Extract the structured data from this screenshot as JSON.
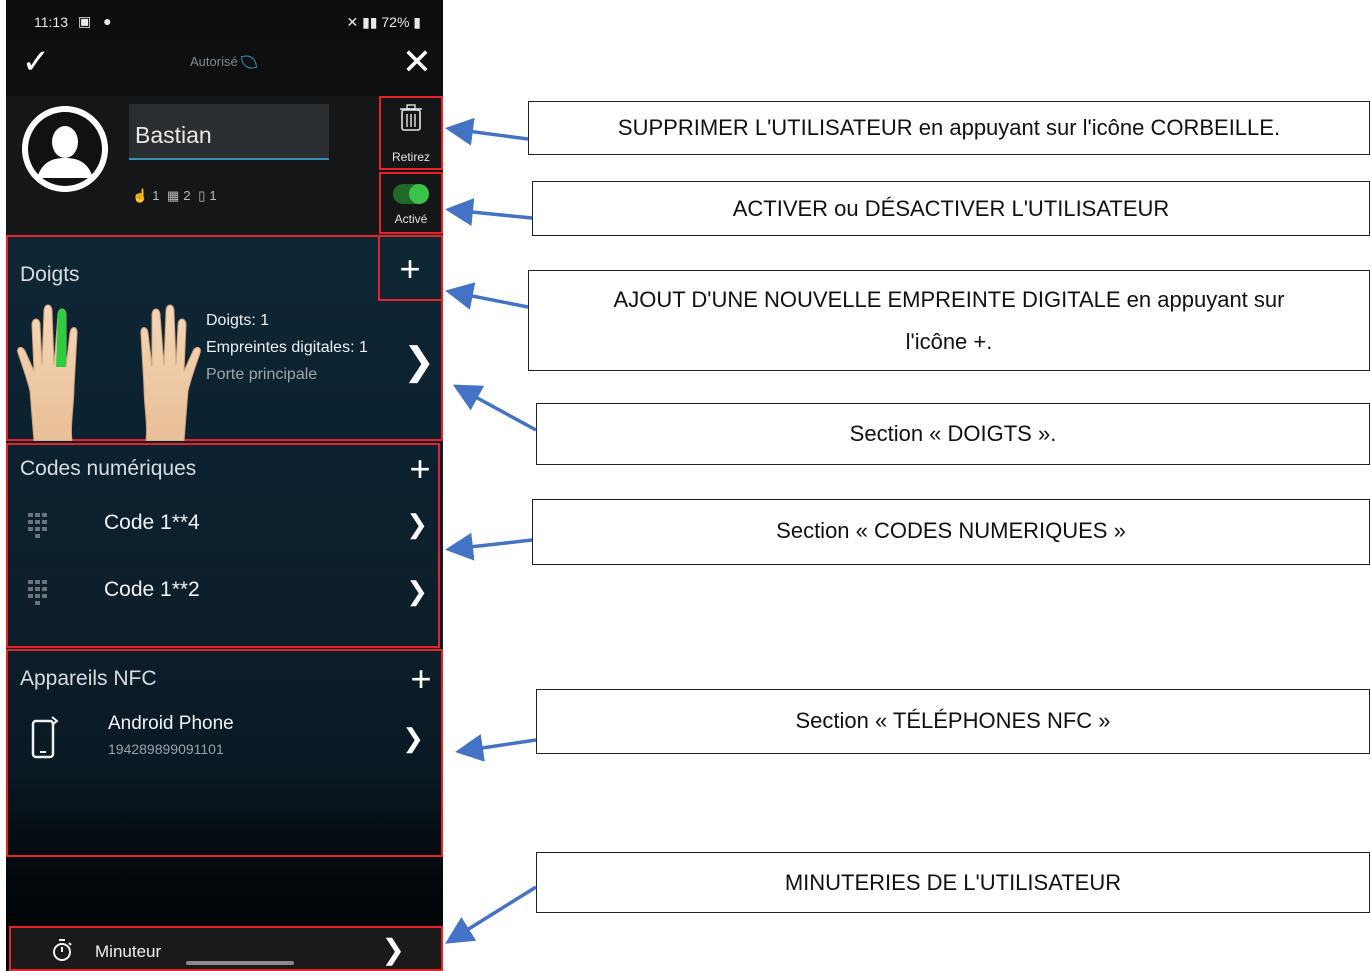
{
  "status_bar": {
    "time": "11:13",
    "left_icons": "▣ ●",
    "right_icons": "72%"
  },
  "top_bar": {
    "status_label": "Autorisé"
  },
  "profile": {
    "name": "Bastian",
    "fingers_count": "1",
    "codes_count": "2",
    "phones_count": "1"
  },
  "actions": {
    "remove_label": "Retirez",
    "active_label": "Activé",
    "active": true
  },
  "doigts": {
    "title": "Doigts",
    "fingers_line": "Doigts: 1",
    "prints_line": "Empreintes digitales: 1",
    "door": "Porte principale"
  },
  "codes": {
    "title": "Codes numériques",
    "items": [
      {
        "label": "Code 1**4"
      },
      {
        "label": "Code 1**2"
      }
    ]
  },
  "nfc": {
    "title": "Appareils NFC",
    "device_name": "Android Phone",
    "device_id": "194289899091101"
  },
  "timer": {
    "label": "Minuteur"
  },
  "callouts": {
    "delete": "SUPPRIMER L'UTILISATEUR en appuyant sur l'icône CORBEILLE.",
    "toggle": "ACTIVER ou DÉSACTIVER L'UTILISATEUR",
    "add_fingerprint_line1": "AJOUT D'UNE NOUVELLE EMPREINTE DIGITALE en appuyant sur",
    "add_fingerprint_line2": "l'icône +.",
    "section_doigts": "Section « DOIGTS ».",
    "section_codes": "Section « CODES NUMERIQUES »",
    "section_nfc": "Section « TÉLÉPHONES NFC »",
    "timers": "MINUTERIES DE L'UTILISATEUR"
  },
  "colors": {
    "highlight_red": "#e52328",
    "arrow_blue": "#4472c4",
    "toggle_green": "#3ac24a",
    "finger_green": "#2ecc40"
  }
}
